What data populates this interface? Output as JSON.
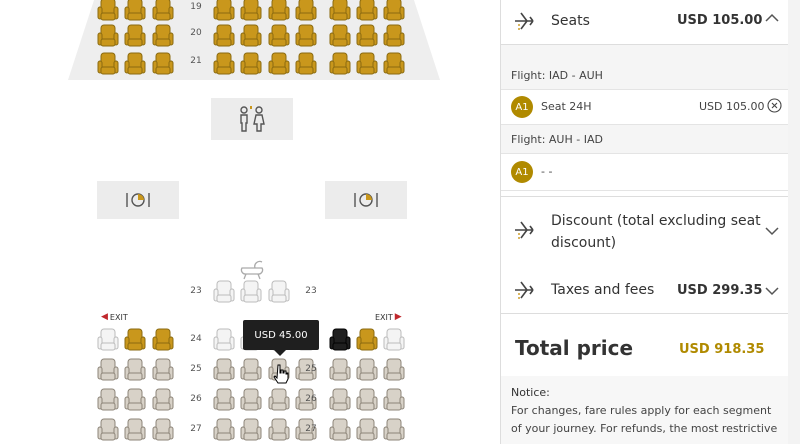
{
  "seatmap": {
    "top_rows": [
      "19",
      "20",
      "21"
    ],
    "mid_rows_left": [
      "23",
      "24",
      "25",
      "26",
      "27"
    ],
    "mid_rows_right": [
      "23",
      "24",
      "25",
      "26",
      "27"
    ],
    "exit_left": "EXIT",
    "exit_right": "EXIT",
    "tooltip_price": "USD 45.00",
    "colors": {
      "premium": "#c9971c",
      "standard": "#d8d2c8",
      "free": "#f4f4f4",
      "selected": "#1f1f1f"
    }
  },
  "panel": {
    "seats": {
      "title": "Seats",
      "price": "USD 105.00"
    },
    "flights": [
      {
        "label": "Flight:  IAD - AUH",
        "badge": "A1",
        "seat": "Seat 24H",
        "price": "USD 105.00"
      },
      {
        "label": "Flight:  AUH - IAD",
        "badge": "A1",
        "seat": "- -"
      }
    ],
    "discount": {
      "line1": "Discount (total excluding seat",
      "line2": "discount)"
    },
    "taxes": {
      "title": "Taxes and fees",
      "price": "USD 299.35"
    },
    "total": {
      "label": "Total price",
      "price": "USD 918.35"
    },
    "notice": {
      "heading": "Notice:",
      "line1": "For changes, fare rules apply for each segment",
      "line2": "of your journey. For refunds, the most restrictive"
    }
  }
}
